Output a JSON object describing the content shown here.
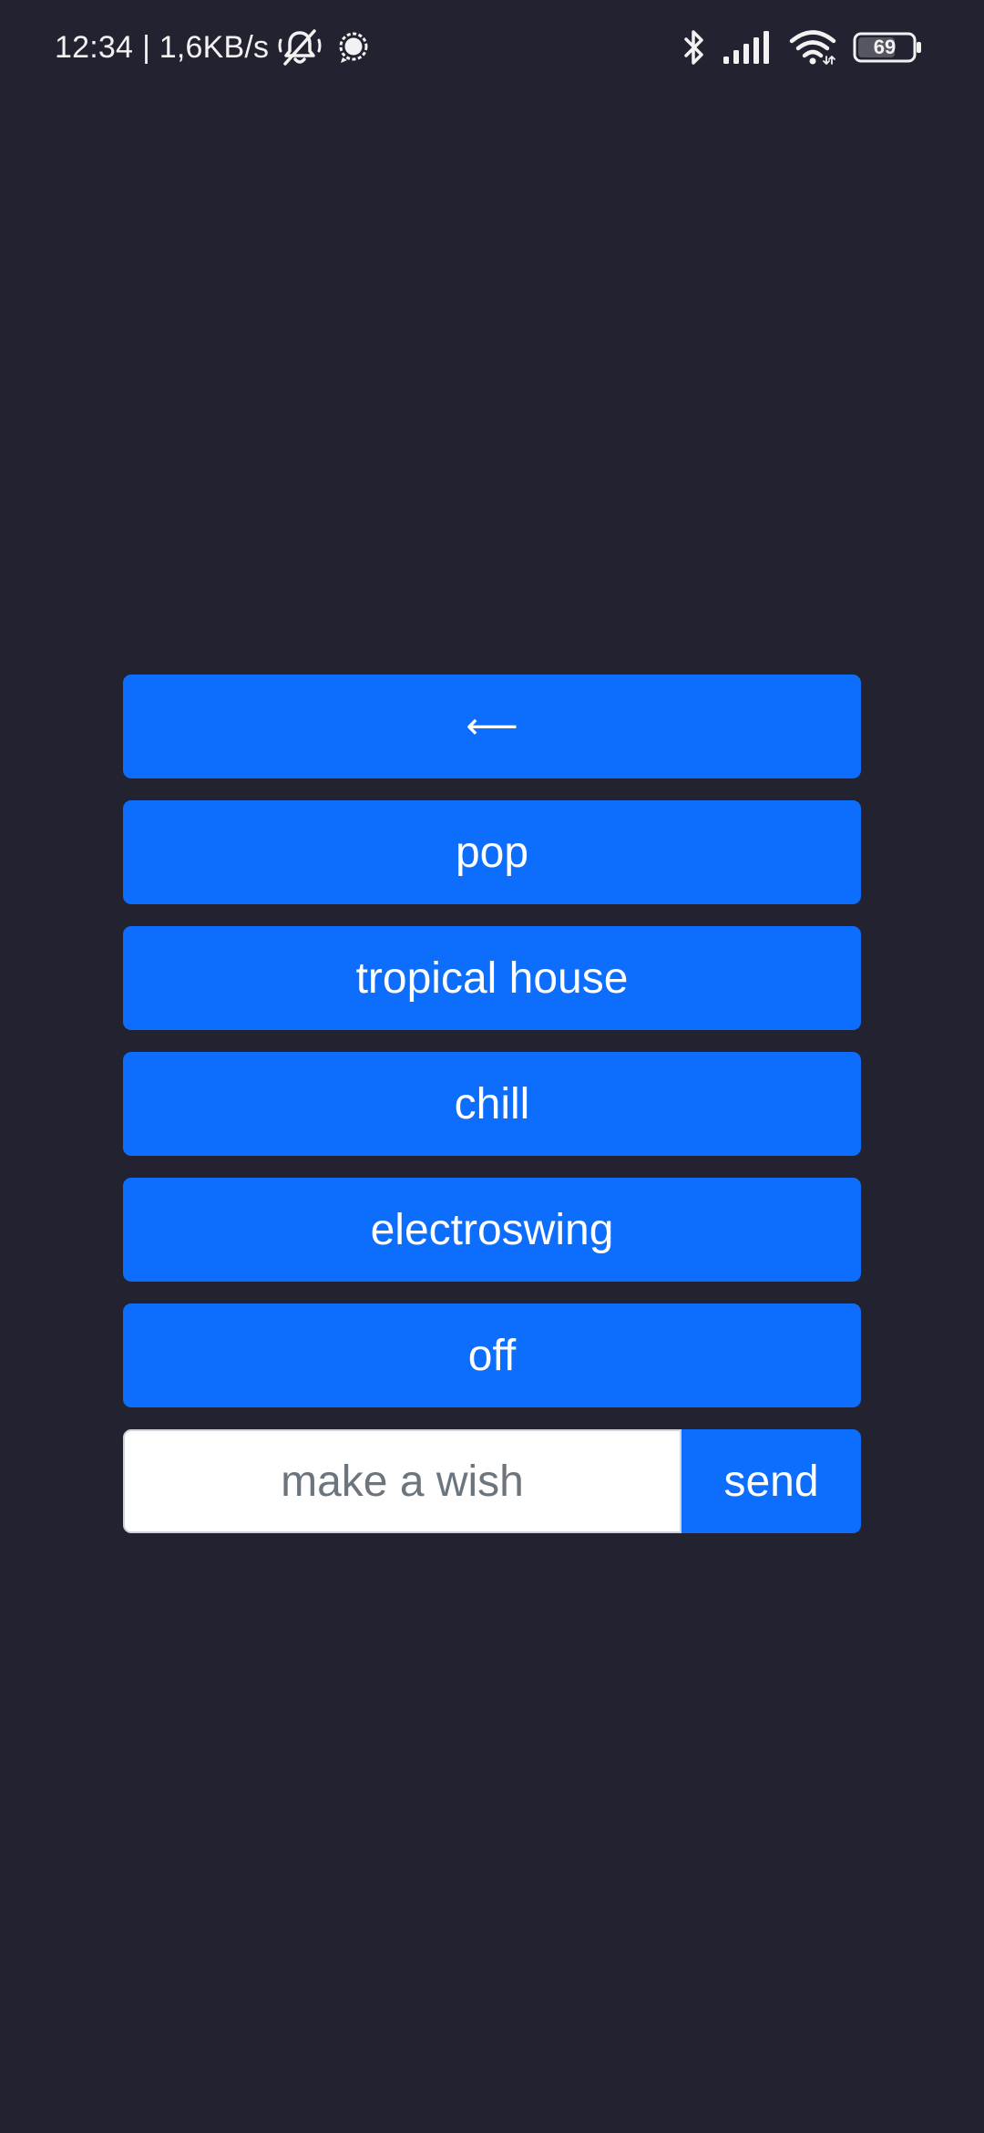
{
  "status_bar": {
    "time": "12:34",
    "network_speed": "| 1,6KB/s",
    "battery_level": "69",
    "icons": [
      "notifications-off-icon",
      "chat-bubble-icon",
      "bluetooth-icon",
      "signal-icon",
      "wifi-icon",
      "battery-icon"
    ]
  },
  "menu": {
    "back_label": "⟵",
    "items": [
      {
        "label": "pop"
      },
      {
        "label": "tropical house"
      },
      {
        "label": "chill"
      },
      {
        "label": "electroswing"
      },
      {
        "label": "off"
      }
    ]
  },
  "wish": {
    "placeholder": "make a wish",
    "value": "",
    "send_label": "send"
  },
  "colors": {
    "background": "#222231",
    "accent": "#0d6efd",
    "input_background": "#ffffff",
    "placeholder": "#6c757d"
  }
}
